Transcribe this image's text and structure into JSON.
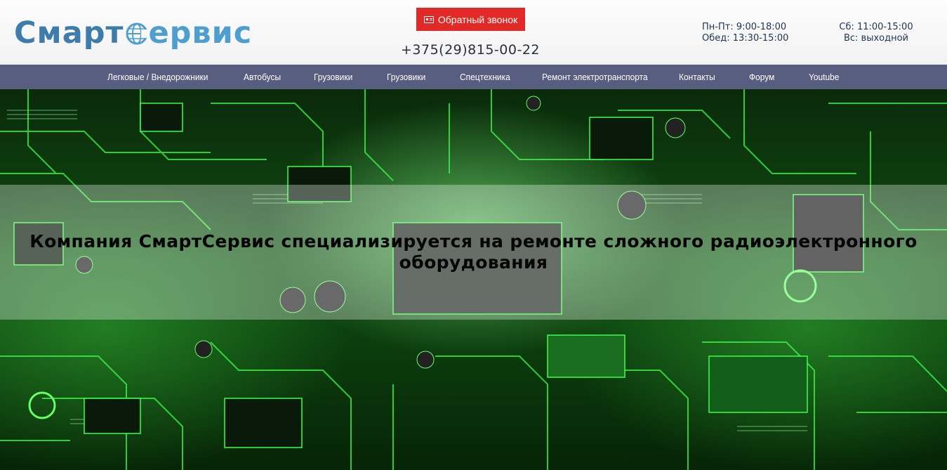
{
  "header": {
    "logo": {
      "part1": "Смарт",
      "part2": "ервис"
    },
    "callback_label": "Обратный звонок",
    "phone": "+375(29)815-00-22",
    "hours_week": [
      "Пн-Пт: 9:00-18:00",
      "Обед: 13:30-15:00"
    ],
    "hours_weekend": [
      "Сб: 11:00-15:00",
      "Вс: выходной"
    ]
  },
  "nav": {
    "items": [
      {
        "label": "Легковые / Внедорожники"
      },
      {
        "label": "Автобусы"
      },
      {
        "label": "Грузовики"
      },
      {
        "label": "Грузовики"
      },
      {
        "label": "Спецтехника"
      },
      {
        "label": "Ремонт электротранспорта"
      },
      {
        "label": "Контакты"
      },
      {
        "label": "Форум"
      },
      {
        "label": "Youtube"
      }
    ]
  },
  "hero": {
    "heading": "Компания СмартСервис специализируется на ремонте сложного радиоэлектронного оборудования"
  },
  "icons": {
    "callback": "card-icon",
    "logo_globe": "globe-icon"
  },
  "colors": {
    "callback_bg": "#e12a27",
    "nav_bg": "#585e7f",
    "logo_dark": "#3d7cab",
    "logo_light": "#4f9ed0",
    "circuit_green": "#3dff48"
  }
}
